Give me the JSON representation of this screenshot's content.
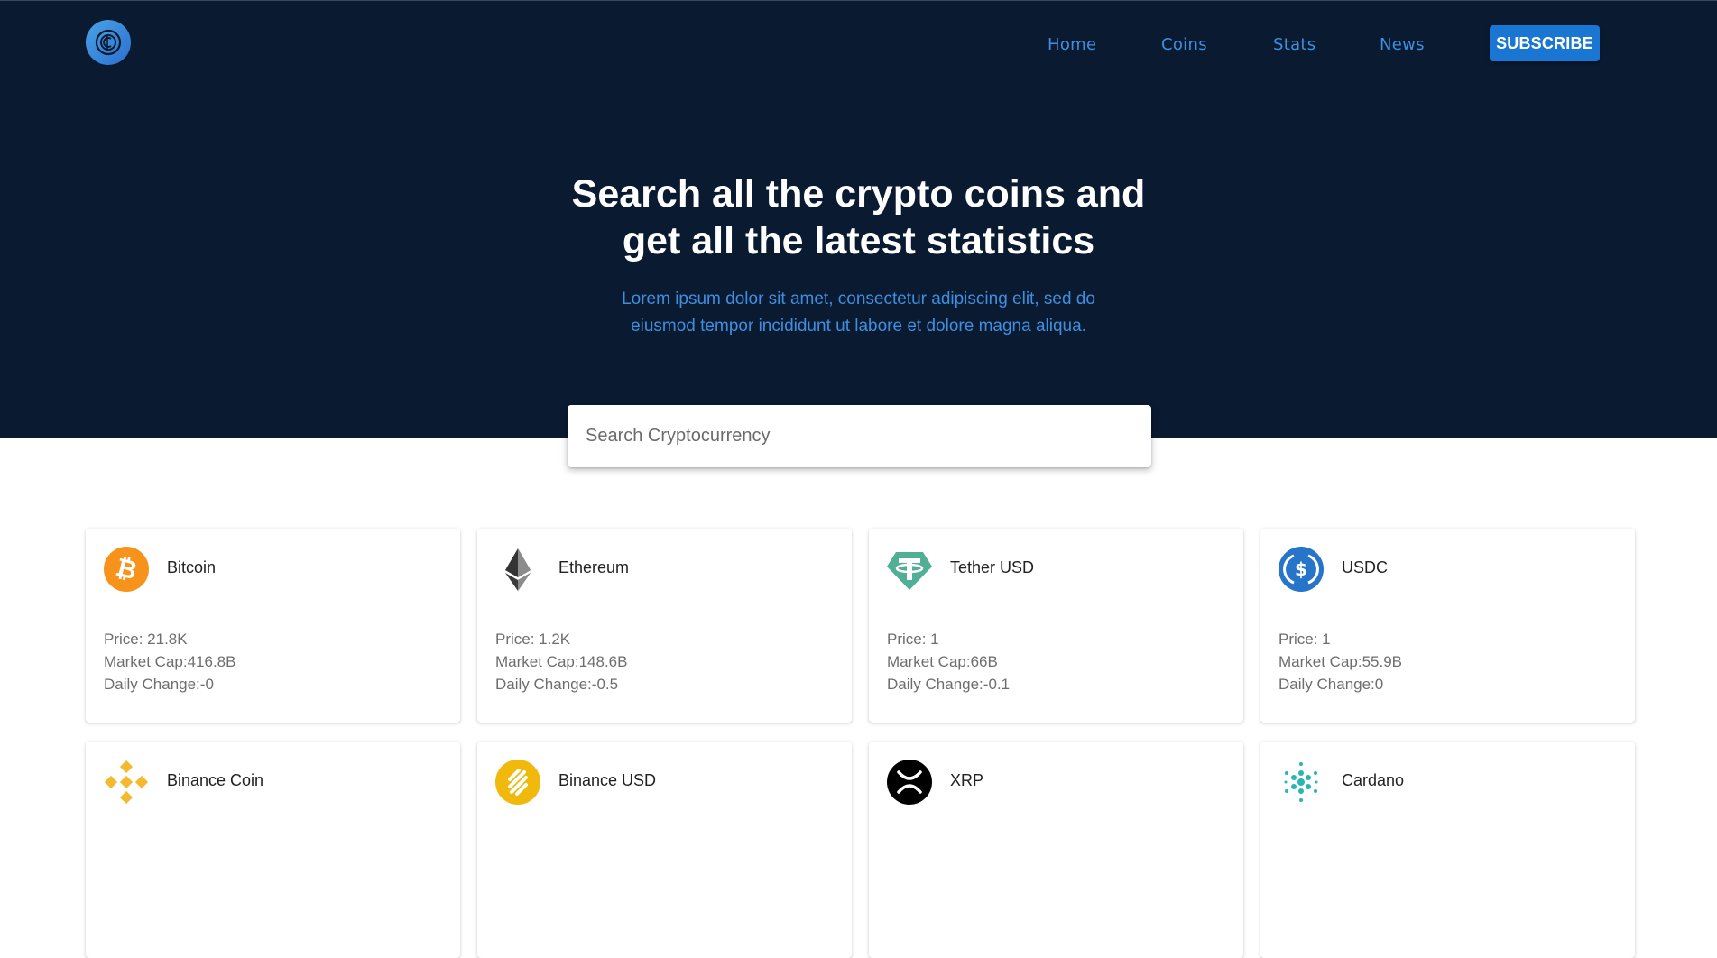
{
  "nav": {
    "logo": "cryptoverse-logo-icon",
    "links": [
      "Home",
      "Coins",
      "Stats",
      "News"
    ],
    "subscribe_label": "SUBSCRIBE"
  },
  "hero": {
    "headline_line1": "Search all the crypto coins and",
    "headline_line2": "get all the latest statistics",
    "subtext_line1": "Lorem ipsum dolor sit amet, consectetur adipiscing elit, sed do",
    "subtext_line2": "eiusmod tempor incididunt ut labore et dolore magna aliqua."
  },
  "search": {
    "placeholder": "Search Cryptocurrency"
  },
  "colors": {
    "hero_bg": "#0a1a30",
    "accent": "#3f8fe0",
    "button": "#1976d2"
  },
  "coins": [
    {
      "name": "Bitcoin",
      "icon": "bitcoin-icon",
      "price": "Price: 21.8K",
      "market_cap": "Market Cap:416.8B",
      "daily_change": "Daily Change:-0"
    },
    {
      "name": "Ethereum",
      "icon": "ethereum-icon",
      "price": "Price: 1.2K",
      "market_cap": "Market Cap:148.6B",
      "daily_change": "Daily Change:-0.5"
    },
    {
      "name": "Tether USD",
      "icon": "tether-icon",
      "price": "Price: 1",
      "market_cap": "Market Cap:66B",
      "daily_change": "Daily Change:-0.1"
    },
    {
      "name": "USDC",
      "icon": "usdc-icon",
      "price": "Price: 1",
      "market_cap": "Market Cap:55.9B",
      "daily_change": "Daily Change:0"
    },
    {
      "name": "Binance Coin",
      "icon": "binance-coin-icon"
    },
    {
      "name": "Binance USD",
      "icon": "binance-usd-icon"
    },
    {
      "name": "XRP",
      "icon": "xrp-icon"
    },
    {
      "name": "Cardano",
      "icon": "cardano-icon"
    }
  ]
}
